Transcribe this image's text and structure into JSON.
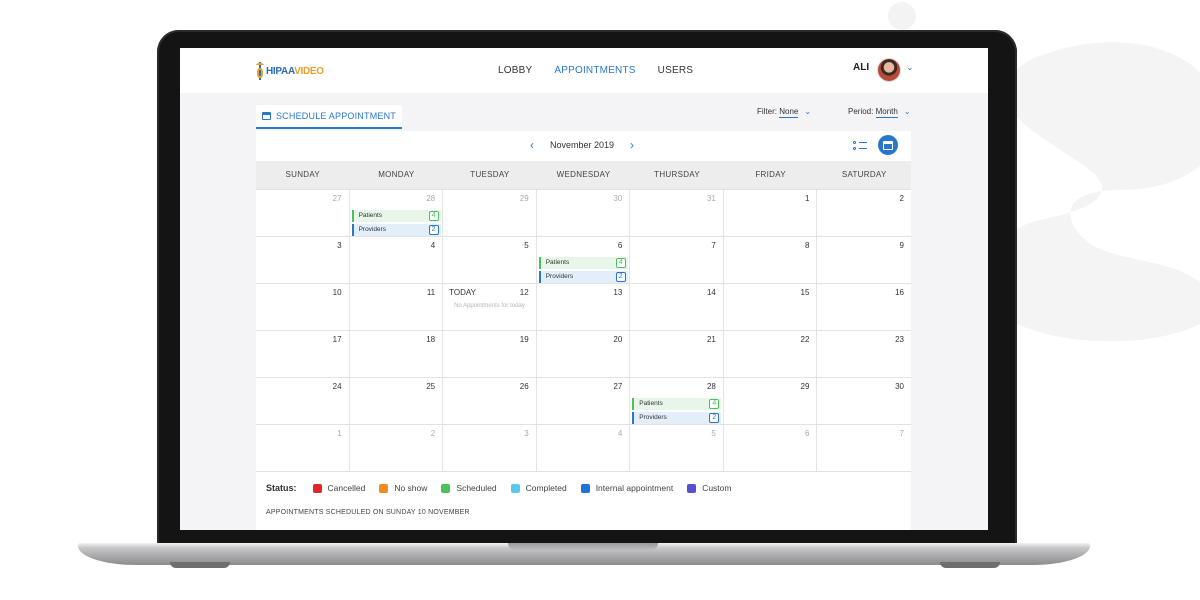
{
  "logo": {
    "part1": "HIPAA",
    "part2": "VIDEO"
  },
  "nav": {
    "items": [
      "LOBBY",
      "APPOINTMENTS",
      "USERS"
    ],
    "active": "APPOINTMENTS"
  },
  "user": {
    "name": "ALI"
  },
  "toolbar": {
    "schedule_label": "SCHEDULE APPOINTMENT",
    "filter_label": "Filter:",
    "filter_value": "None",
    "period_label": "Period:",
    "period_value": "Month"
  },
  "calendar": {
    "month": "November 2019",
    "weekdays": [
      "SUNDAY",
      "MONDAY",
      "TUESDAY",
      "WEDNESDAY",
      "THURSDAY",
      "FRIDAY",
      "SATURDAY"
    ],
    "weeks": [
      [
        {
          "d": "27",
          "m": true
        },
        {
          "d": "28",
          "m": true,
          "p": "4",
          "v": "2"
        },
        {
          "d": "29",
          "m": true
        },
        {
          "d": "30",
          "m": true
        },
        {
          "d": "31",
          "m": true
        },
        {
          "d": "1"
        },
        {
          "d": "2"
        }
      ],
      [
        {
          "d": "3"
        },
        {
          "d": "4"
        },
        {
          "d": "5"
        },
        {
          "d": "6",
          "p": "4",
          "v": "2"
        },
        {
          "d": "7"
        },
        {
          "d": "8"
        },
        {
          "d": "9"
        }
      ],
      [
        {
          "d": "10"
        },
        {
          "d": "11"
        },
        {
          "d": "12",
          "today": true
        },
        {
          "d": "13"
        },
        {
          "d": "14"
        },
        {
          "d": "15"
        },
        {
          "d": "16"
        }
      ],
      [
        {
          "d": "17"
        },
        {
          "d": "18"
        },
        {
          "d": "19"
        },
        {
          "d": "20"
        },
        {
          "d": "21"
        },
        {
          "d": "22"
        },
        {
          "d": "23"
        }
      ],
      [
        {
          "d": "24"
        },
        {
          "d": "25"
        },
        {
          "d": "26"
        },
        {
          "d": "27"
        },
        {
          "d": "28",
          "p": "4",
          "v": "2"
        },
        {
          "d": "29"
        },
        {
          "d": "30"
        }
      ],
      [
        {
          "d": "1",
          "m": true
        },
        {
          "d": "2",
          "m": true
        },
        {
          "d": "3",
          "m": true
        },
        {
          "d": "4",
          "m": true
        },
        {
          "d": "5",
          "m": true
        },
        {
          "d": "6",
          "m": true
        },
        {
          "d": "7",
          "m": true
        }
      ]
    ],
    "patients_label": "Patients",
    "providers_label": "Providers",
    "today_label": "TODAY",
    "no_appointments": "No Appointments for today"
  },
  "status": {
    "title": "Status:",
    "items": [
      {
        "label": "Cancelled",
        "color": "#e0262a"
      },
      {
        "label": "No show",
        "color": "#f28c22"
      },
      {
        "label": "Scheduled",
        "color": "#4cc35a"
      },
      {
        "label": "Completed",
        "color": "#5bc8ef"
      },
      {
        "label": "Internal appointment",
        "color": "#1f73d6"
      },
      {
        "label": "Custom",
        "color": "#5b4fd0"
      }
    ]
  },
  "footer_caption": "APPOINTMENTS SCHEDULED ON SUNDAY 10 NOVEMBER",
  "colors": {
    "accent": "#2a77c9",
    "patients": "#4cc35a",
    "providers": "#2a77c9"
  }
}
